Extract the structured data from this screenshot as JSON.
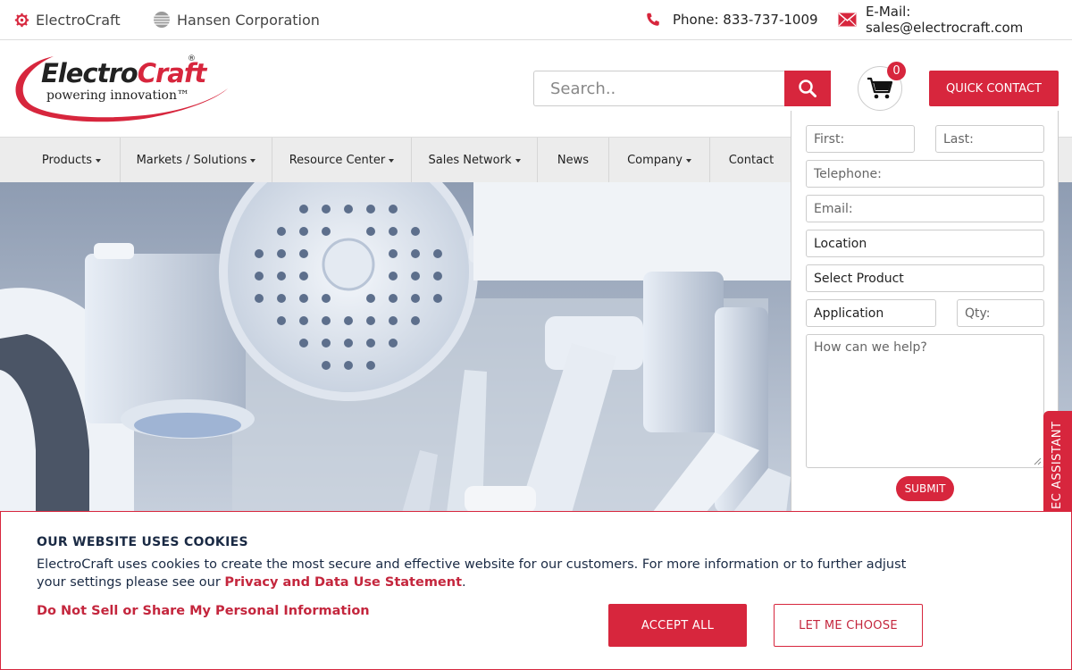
{
  "topbar": {
    "brand1": "ElectroCraft",
    "brand2": "Hansen Corporation",
    "phone": "Phone: 833-737-1009",
    "email": "E-Mail: sales@electrocraft.com"
  },
  "header": {
    "logo_electro": "Electro",
    "logo_craft": "Craft",
    "logo_reg": "®",
    "logo_tagline": "powering innovation™",
    "search_placeholder": "Search..",
    "cart_count": "0",
    "quick_contact": "QUICK CONTACT"
  },
  "nav": {
    "items": [
      {
        "label": "Products"
      },
      {
        "label": "Markets / Solutions"
      },
      {
        "label": "Resource Center"
      },
      {
        "label": "Sales Network"
      },
      {
        "label": "News"
      },
      {
        "label": "Company"
      },
      {
        "label": "Contact"
      }
    ]
  },
  "contact_form": {
    "first": "First:",
    "last": "Last:",
    "telephone": "Telephone:",
    "email": "Email:",
    "location": "Location",
    "product": "Select Product",
    "application": "Application",
    "qty": "Qty:",
    "message": "How can we help?",
    "submit": "SUBMIT"
  },
  "side_tab": {
    "label": "EC ASSISTANT"
  },
  "cookie": {
    "title": "OUR WEBSITE USES COOKIES",
    "text": "ElectroCraft uses cookies to create the most secure and effective website for our customers. For more information or to further adjust your settings please see our",
    "policy_link": "Privacy and Data Use Statement",
    "period": ".",
    "do_not_sell": "Do Not Sell or Share My Personal Information",
    "accept": "ACCEPT ALL",
    "choose": "LET ME CHOOSE"
  },
  "colors": {
    "accent": "#d7263d",
    "dark_text": "#1a2a44",
    "nav_bg": "#ececec"
  }
}
